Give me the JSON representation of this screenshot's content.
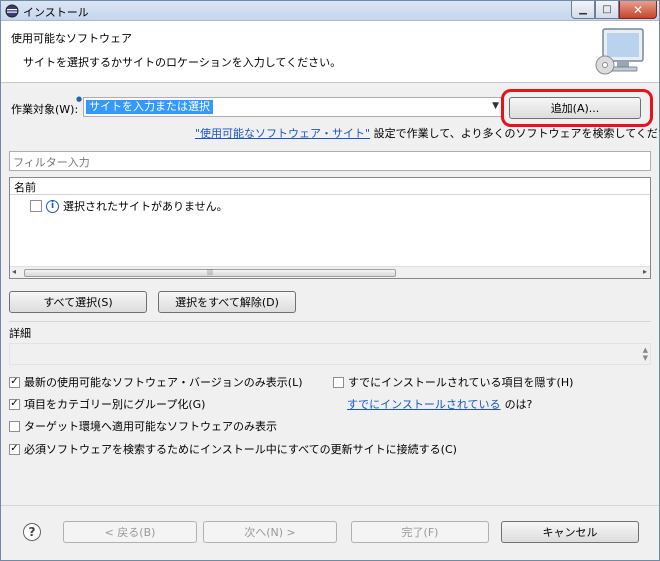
{
  "window": {
    "title": "インストール"
  },
  "header": {
    "title": "使用可能なソフトウェア",
    "description": "サイトを選択するかサイトのロケーションを入力してください。"
  },
  "work_with": {
    "label": "作業対象(W):",
    "value": "サイトを入力または選択",
    "add_button": "追加(A)...",
    "hint_link": "\"使用可能なソフトウェア・サイト\"",
    "hint_text": " 設定で作業して、より多くのソフトウェアを検索してください。"
  },
  "filter": {
    "placeholder": "フィルター入力"
  },
  "table": {
    "column_name": "名前",
    "empty_message": "選択されたサイトがありません。"
  },
  "buttons": {
    "select_all": "すべて選択(S)",
    "deselect_all": "選択をすべて解除(D)",
    "back": "< 戻る(B)",
    "next": "次へ(N) >",
    "finish": "完了(F)",
    "cancel": "キャンセル"
  },
  "details": {
    "label": "詳細"
  },
  "options": {
    "latest_only": "最新の使用可能なソフトウェア・バージョンのみ表示(L)",
    "hide_installed": "すでにインストールされている項目を隠す(H)",
    "group_by_category": "項目をカテゴリー別にグループ化(G)",
    "what_installed_link": "すでにインストールされている",
    "what_installed_suffix": " のは?",
    "target_env_only": "ターゲット環境へ適用可能なソフトウェアのみ表示",
    "contact_all_sites": "必須ソフトウェアを検索するためにインストール中にすべての更新サイトに接続する(C)"
  },
  "option_states": {
    "latest_only": true,
    "hide_installed": false,
    "group_by_category": true,
    "target_env_only": false,
    "contact_all_sites": true
  }
}
